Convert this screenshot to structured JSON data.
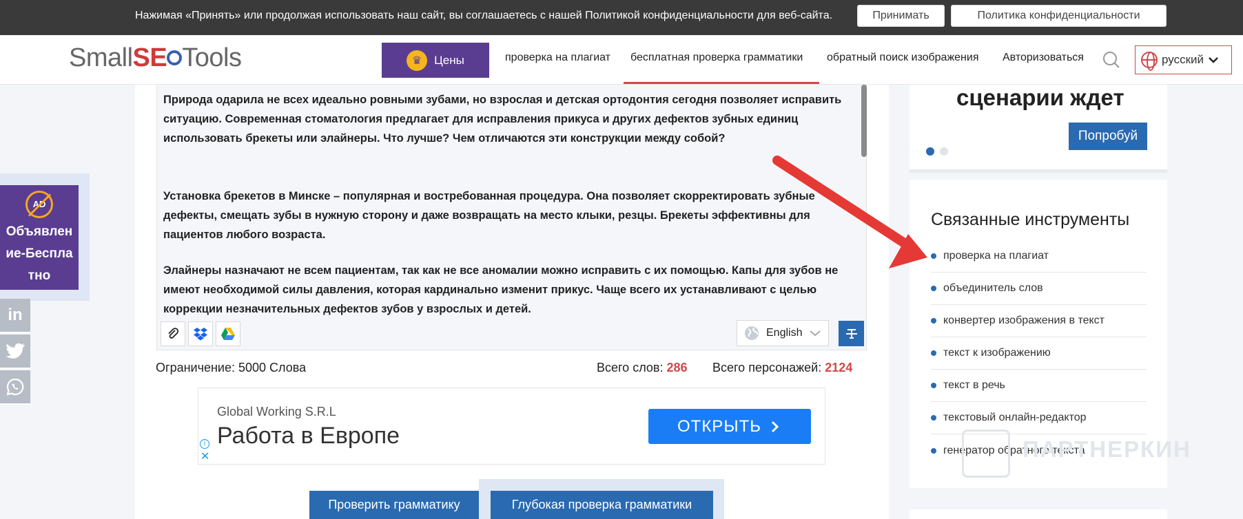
{
  "cookie": {
    "text": "Нажимая «Принять» или продолжая использовать наш сайт, вы соглашаетесь с нашей Политикой конфиденциальности для веб-сайта.",
    "accept_label": "Принимать",
    "policy_label": "Политика конфиденциальности"
  },
  "header": {
    "logo_part1": "Small",
    "logo_seo": "SE",
    "logo_part2": "Tools",
    "pricing_label": "Цены",
    "nav": [
      "проверка на плагиат",
      "бесплатная проверка грамматики",
      "обратный поиск изображения",
      "Авторизоваться"
    ],
    "language": "русский"
  },
  "editor": {
    "paragraphs": [
      "Природа одарила не всех идеально ровными зубами, но взрослая и детская ортодонтия сегодня позволяет исправить ситуацию. Современная стоматология предлагает для исправления прикуса и других дефектов зубных единиц использовать брекеты или элайнеры. Что лучше? Чем отличаются эти конструкции между собой?",
      "Установка брекетов в Минске – популярная и востребованная процедура. Она позволяет скорректировать зубные дефекты, смещать зубы в нужную сторону и даже возвращать на место клыки, резцы. Брекеты эффективны для пациентов любого возраста.",
      "Элайнеры назначают не всем пациентам, так как не все аномалии можно исправить с их помощью. Капы для зубов не имеют необходимой силы давления, которая кардинально изменит прикус. Чаще всего их устанавливают с целью коррекции незначительных дефектов зубов у взрослых и детей."
    ],
    "language": "English"
  },
  "stats": {
    "limit": "Ограничение: 5000 Слова",
    "words_label": "Всего слов:",
    "words": "286",
    "chars_label": "Всего персонажей:",
    "chars": "2124"
  },
  "ad": {
    "company": "Global Working S.R.L",
    "title": "Работа в Европе",
    "button": "ОТКРЫТЬ"
  },
  "actions": {
    "check": "Проверить грамматику",
    "deep_check": "Глубокая проверка грамматики"
  },
  "ad_free": {
    "icon_text": "AD",
    "label": "Объявление-Бесплатно"
  },
  "social": {
    "linkedin": "in"
  },
  "promo": {
    "title": "сценарии ждет",
    "button": "Попробуй"
  },
  "related": {
    "title": "Связанные инструменты",
    "items": [
      "проверка на плагиат",
      "объединитель слов",
      "конвертер изображения в текст",
      "текст к изображению",
      "текст в речь",
      "текстовый онлайн-редактор",
      "генератор обратного текста"
    ]
  },
  "watermark": "ПАРТНЕРКИН",
  "colors": {
    "accent_blue": "#2a6ab0",
    "purple": "#5a3d91",
    "red": "#d04848",
    "arrow": "#e53935"
  }
}
